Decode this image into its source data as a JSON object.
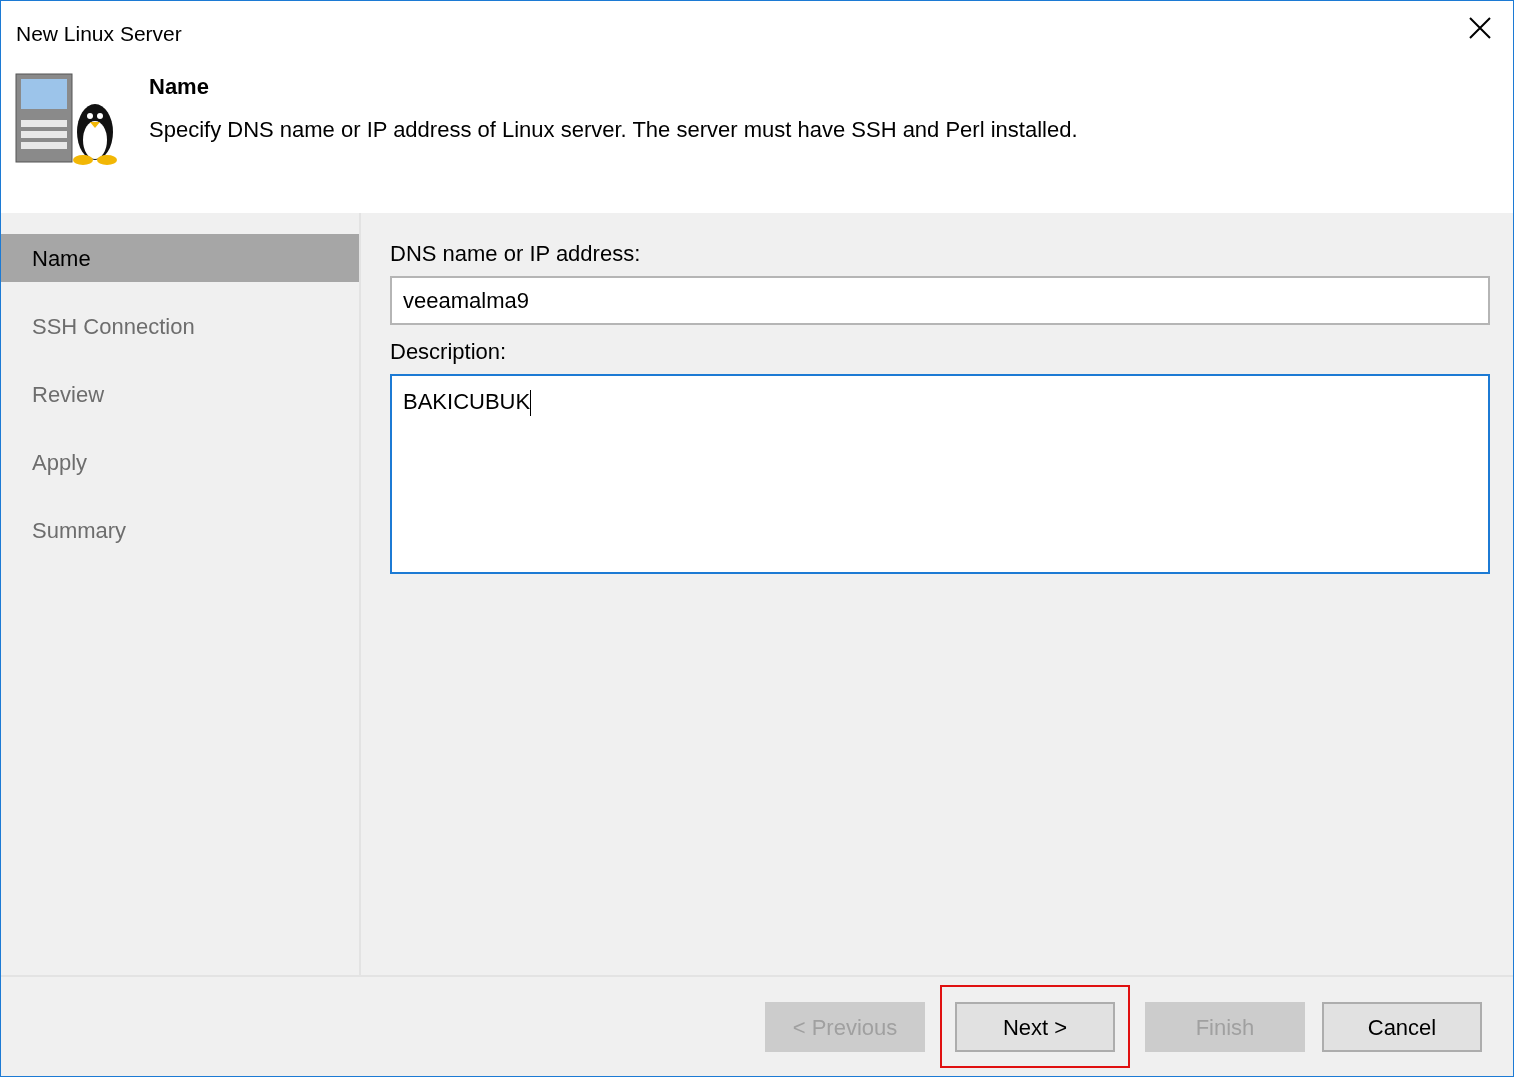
{
  "window": {
    "title": "New Linux Server"
  },
  "header": {
    "title": "Name",
    "description": "Specify DNS name or IP address of Linux server. The server must have SSH and Perl installed."
  },
  "steps": [
    {
      "label": "Name",
      "selected": true
    },
    {
      "label": "SSH Connection",
      "selected": false
    },
    {
      "label": "Review",
      "selected": false
    },
    {
      "label": "Apply",
      "selected": false
    },
    {
      "label": "Summary",
      "selected": false
    }
  ],
  "fields": [
    {
      "kind": "line",
      "label": "DNS name or IP address:",
      "value": "veeamalma9",
      "focused": false
    },
    {
      "kind": "area",
      "label": "Description:",
      "value": "BAKICUBUK",
      "focused": true
    }
  ],
  "buttons": [
    {
      "label": "< Previous",
      "disabled": true,
      "highlighted": false
    },
    {
      "label": "Next >",
      "disabled": false,
      "highlighted": true
    },
    {
      "label": "Finish",
      "disabled": true,
      "highlighted": false
    },
    {
      "label": "Cancel",
      "disabled": false,
      "highlighted": false
    }
  ]
}
